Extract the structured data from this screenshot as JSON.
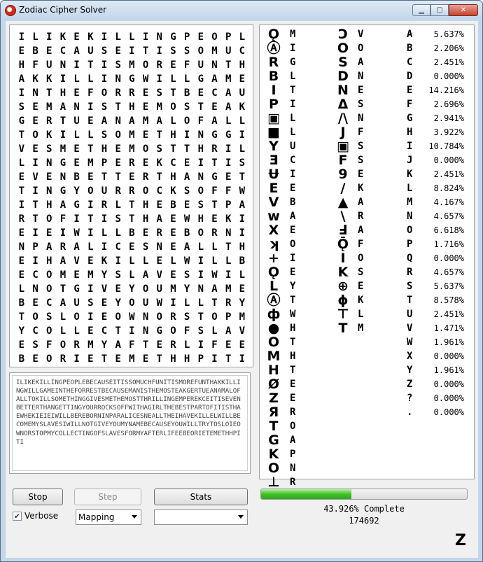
{
  "window": {
    "title": "Zodiac Cipher Solver"
  },
  "grid_rows": [
    "ILIKEKILLINGPEOPL",
    "EBECAUSEITISSOMUC",
    "HFUNITISMOREFUNTH",
    "AKKILLINGWILLGAME",
    "INTHEFORRESTBECAU",
    "SEMANISTHEMOSTEAK",
    "GERTUEANAMALOFALL",
    "TOKILLSOMETHINGGI",
    "VESMETHEMOSTTHRIL",
    "LINGEMPEREKCEITIS",
    "EVENBETTERTHANGET",
    "TINGYOURROCKSOFFW",
    "ITHAGIRLTHEBESTPA",
    "RTOFITISTHAEWHEKI",
    "EIEIWILLBEREBORNI",
    "NPARALICESNEALLTH",
    "EIHAVEKILLELWILLB",
    "ECOMEMYSLAVESIWIL",
    "LNOTGIVEYOUMYNAME",
    "BECAUSEYOUWILLTRY",
    "TOSLOIEOWNORSTOPM",
    "YCOLLECTINGOFSLAV",
    "ESFORMYAFTERLIFEE",
    "BEORIETEMETHHPITI"
  ],
  "solution_text": "ILIKEKILLINGPEOPLEBECAUSEITISSOMUCHFUNITISMOREFUNTHAKKILLINGWILLGAMEINTHEFORRESTBECAUSEMANISTHEMOSTEAKGERTUEANAMALOFALLTOKILLSOMETHINGGIVESMETHEMOSTTHRILLINGEMPEREKCEITISEVENBETTERTHANGETTINGYOURROCKSOFFWITHAGIRLTHEBESTPARTOFITISTHAEWHEKIEIEIWILLBEREBORNINPARALICESNEALLTHEIHAVEKILLELWILLBECOMEMYSLAVESIWILLNOTGIVEYOUMYNAMEBECAUSEYOUWILLTRYTOSLOIEOWNORSTOPMYCOLLECTINGOFSLAVESFORMYAFTERLIFEEBEORIETEMETHHPITI",
  "key_col1": [
    {
      "sym": "Ǫ",
      "plain": "M"
    },
    {
      "sym": "Ⓐ",
      "plain": "I"
    },
    {
      "sym": "R",
      "plain": "G"
    },
    {
      "sym": "B",
      "plain": "L"
    },
    {
      "sym": "I",
      "plain": "T"
    },
    {
      "sym": "P",
      "plain": "I"
    },
    {
      "sym": "▣",
      "plain": "L"
    },
    {
      "sym": "■",
      "plain": "L"
    },
    {
      "sym": "Y",
      "plain": "U"
    },
    {
      "sym": "Ǝ",
      "plain": "C"
    },
    {
      "sym": "Ʉ",
      "plain": "I"
    },
    {
      "sym": "E",
      "plain": "E"
    },
    {
      "sym": "V",
      "plain": "B"
    },
    {
      "sym": "w",
      "plain": "A"
    },
    {
      "sym": "X",
      "plain": "E"
    },
    {
      "sym": "ʞ",
      "plain": "O"
    },
    {
      "sym": "+",
      "plain": "I"
    },
    {
      "sym": "Ǫ",
      "plain": "E"
    },
    {
      "sym": "L",
      "plain": "Y"
    },
    {
      "sym": "Ⓐ",
      "plain": "T"
    },
    {
      "sym": "ф",
      "plain": "W"
    },
    {
      "sym": "●",
      "plain": "H"
    },
    {
      "sym": "O",
      "plain": "T"
    },
    {
      "sym": "M",
      "plain": "H"
    },
    {
      "sym": "H",
      "plain": "T"
    },
    {
      "sym": "Ø",
      "plain": "E"
    },
    {
      "sym": "Z",
      "plain": "E"
    },
    {
      "sym": "Я",
      "plain": "R"
    },
    {
      "sym": "T",
      "plain": "O"
    },
    {
      "sym": "G",
      "plain": "A"
    },
    {
      "sym": "K",
      "plain": "P"
    },
    {
      "sym": "O",
      "plain": "N"
    },
    {
      "sym": "⊥",
      "plain": "R"
    }
  ],
  "key_col2": [
    {
      "sym": "Ↄ",
      "plain": "V"
    },
    {
      "sym": "O",
      "plain": "O"
    },
    {
      "sym": "S",
      "plain": "A"
    },
    {
      "sym": "D",
      "plain": "N"
    },
    {
      "sym": "N",
      "plain": "E"
    },
    {
      "sym": "Δ",
      "plain": "S"
    },
    {
      "sym": "/\\",
      "plain": "N"
    },
    {
      "sym": "J",
      "plain": "F"
    },
    {
      "sym": "▣",
      "plain": "S"
    },
    {
      "sym": "F",
      "plain": "S"
    },
    {
      "sym": "9",
      "plain": "E"
    },
    {
      "sym": "/",
      "plain": "K"
    },
    {
      "sym": "▲",
      "plain": "A"
    },
    {
      "sym": "\\",
      "plain": "R"
    },
    {
      "sym": "Ⅎ",
      "plain": "A"
    },
    {
      "sym": "Ǭ",
      "plain": "F"
    },
    {
      "sym": "I",
      "plain": "O"
    },
    {
      "sym": "K",
      "plain": "S"
    },
    {
      "sym": "⊕",
      "plain": "E"
    },
    {
      "sym": "ϕ",
      "plain": "K"
    },
    {
      "sym": "⊤",
      "plain": "L"
    },
    {
      "sym": "T",
      "plain": "M"
    }
  ],
  "frequencies": [
    {
      "letter": "A",
      "pct": "5.637%"
    },
    {
      "letter": "B",
      "pct": "2.206%"
    },
    {
      "letter": "C",
      "pct": "2.451%"
    },
    {
      "letter": "D",
      "pct": "0.000%"
    },
    {
      "letter": "E",
      "pct": "14.216%"
    },
    {
      "letter": "F",
      "pct": "2.696%"
    },
    {
      "letter": "G",
      "pct": "2.941%"
    },
    {
      "letter": "H",
      "pct": "3.922%"
    },
    {
      "letter": "I",
      "pct": "10.784%"
    },
    {
      "letter": "J",
      "pct": "0.000%"
    },
    {
      "letter": "K",
      "pct": "2.451%"
    },
    {
      "letter": "L",
      "pct": "8.824%"
    },
    {
      "letter": "M",
      "pct": "4.167%"
    },
    {
      "letter": "N",
      "pct": "4.657%"
    },
    {
      "letter": "O",
      "pct": "6.618%"
    },
    {
      "letter": "P",
      "pct": "1.716%"
    },
    {
      "letter": "Q",
      "pct": "0.000%"
    },
    {
      "letter": "R",
      "pct": "4.657%"
    },
    {
      "letter": "S",
      "pct": "5.637%"
    },
    {
      "letter": "T",
      "pct": "8.578%"
    },
    {
      "letter": "U",
      "pct": "2.451%"
    },
    {
      "letter": "V",
      "pct": "1.471%"
    },
    {
      "letter": "W",
      "pct": "1.961%"
    },
    {
      "letter": "X",
      "pct": "0.000%"
    },
    {
      "letter": "Y",
      "pct": "1.961%"
    },
    {
      "letter": "Z",
      "pct": "0.000%"
    },
    {
      "letter": "?",
      "pct": "0.000%"
    },
    {
      "letter": ".",
      "pct": "0.000%"
    }
  ],
  "controls": {
    "stop_label": "Stop",
    "step_label": "Step",
    "stats_label": "Stats",
    "verbose_label": "Verbose",
    "verbose_checked": true,
    "mode_selected": "Mapping",
    "second_selected": ""
  },
  "progress": {
    "fraction": 0.43926,
    "label": "43.926% Complete",
    "count": "174692"
  },
  "corner_logo": "Z"
}
